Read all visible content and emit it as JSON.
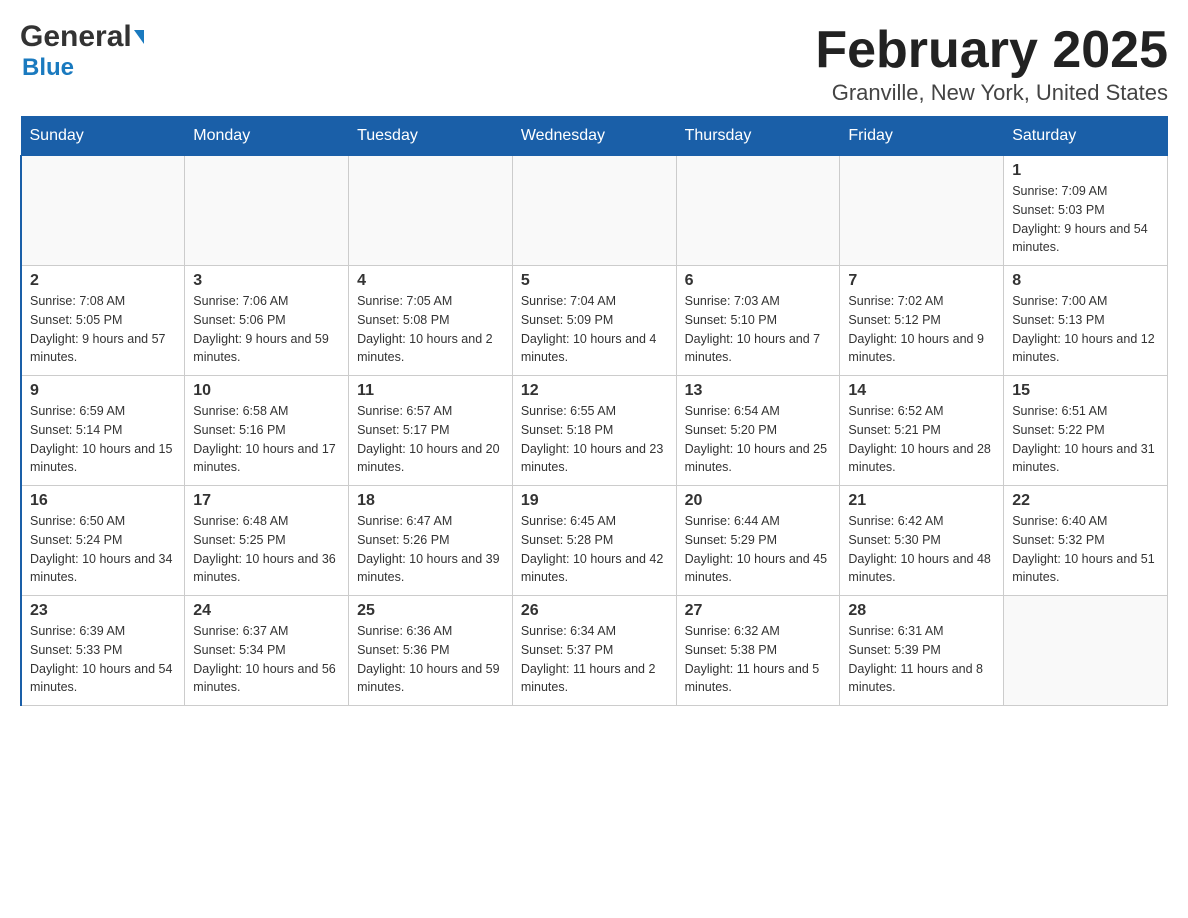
{
  "header": {
    "logo_line1": "General",
    "logo_line2": "Blue",
    "title": "February 2025",
    "subtitle": "Granville, New York, United States"
  },
  "days_of_week": [
    "Sunday",
    "Monday",
    "Tuesday",
    "Wednesday",
    "Thursday",
    "Friday",
    "Saturday"
  ],
  "weeks": [
    [
      {
        "day": "",
        "info": ""
      },
      {
        "day": "",
        "info": ""
      },
      {
        "day": "",
        "info": ""
      },
      {
        "day": "",
        "info": ""
      },
      {
        "day": "",
        "info": ""
      },
      {
        "day": "",
        "info": ""
      },
      {
        "day": "1",
        "info": "Sunrise: 7:09 AM\nSunset: 5:03 PM\nDaylight: 9 hours and 54 minutes."
      }
    ],
    [
      {
        "day": "2",
        "info": "Sunrise: 7:08 AM\nSunset: 5:05 PM\nDaylight: 9 hours and 57 minutes."
      },
      {
        "day": "3",
        "info": "Sunrise: 7:06 AM\nSunset: 5:06 PM\nDaylight: 9 hours and 59 minutes."
      },
      {
        "day": "4",
        "info": "Sunrise: 7:05 AM\nSunset: 5:08 PM\nDaylight: 10 hours and 2 minutes."
      },
      {
        "day": "5",
        "info": "Sunrise: 7:04 AM\nSunset: 5:09 PM\nDaylight: 10 hours and 4 minutes."
      },
      {
        "day": "6",
        "info": "Sunrise: 7:03 AM\nSunset: 5:10 PM\nDaylight: 10 hours and 7 minutes."
      },
      {
        "day": "7",
        "info": "Sunrise: 7:02 AM\nSunset: 5:12 PM\nDaylight: 10 hours and 9 minutes."
      },
      {
        "day": "8",
        "info": "Sunrise: 7:00 AM\nSunset: 5:13 PM\nDaylight: 10 hours and 12 minutes."
      }
    ],
    [
      {
        "day": "9",
        "info": "Sunrise: 6:59 AM\nSunset: 5:14 PM\nDaylight: 10 hours and 15 minutes."
      },
      {
        "day": "10",
        "info": "Sunrise: 6:58 AM\nSunset: 5:16 PM\nDaylight: 10 hours and 17 minutes."
      },
      {
        "day": "11",
        "info": "Sunrise: 6:57 AM\nSunset: 5:17 PM\nDaylight: 10 hours and 20 minutes."
      },
      {
        "day": "12",
        "info": "Sunrise: 6:55 AM\nSunset: 5:18 PM\nDaylight: 10 hours and 23 minutes."
      },
      {
        "day": "13",
        "info": "Sunrise: 6:54 AM\nSunset: 5:20 PM\nDaylight: 10 hours and 25 minutes."
      },
      {
        "day": "14",
        "info": "Sunrise: 6:52 AM\nSunset: 5:21 PM\nDaylight: 10 hours and 28 minutes."
      },
      {
        "day": "15",
        "info": "Sunrise: 6:51 AM\nSunset: 5:22 PM\nDaylight: 10 hours and 31 minutes."
      }
    ],
    [
      {
        "day": "16",
        "info": "Sunrise: 6:50 AM\nSunset: 5:24 PM\nDaylight: 10 hours and 34 minutes."
      },
      {
        "day": "17",
        "info": "Sunrise: 6:48 AM\nSunset: 5:25 PM\nDaylight: 10 hours and 36 minutes."
      },
      {
        "day": "18",
        "info": "Sunrise: 6:47 AM\nSunset: 5:26 PM\nDaylight: 10 hours and 39 minutes."
      },
      {
        "day": "19",
        "info": "Sunrise: 6:45 AM\nSunset: 5:28 PM\nDaylight: 10 hours and 42 minutes."
      },
      {
        "day": "20",
        "info": "Sunrise: 6:44 AM\nSunset: 5:29 PM\nDaylight: 10 hours and 45 minutes."
      },
      {
        "day": "21",
        "info": "Sunrise: 6:42 AM\nSunset: 5:30 PM\nDaylight: 10 hours and 48 minutes."
      },
      {
        "day": "22",
        "info": "Sunrise: 6:40 AM\nSunset: 5:32 PM\nDaylight: 10 hours and 51 minutes."
      }
    ],
    [
      {
        "day": "23",
        "info": "Sunrise: 6:39 AM\nSunset: 5:33 PM\nDaylight: 10 hours and 54 minutes."
      },
      {
        "day": "24",
        "info": "Sunrise: 6:37 AM\nSunset: 5:34 PM\nDaylight: 10 hours and 56 minutes."
      },
      {
        "day": "25",
        "info": "Sunrise: 6:36 AM\nSunset: 5:36 PM\nDaylight: 10 hours and 59 minutes."
      },
      {
        "day": "26",
        "info": "Sunrise: 6:34 AM\nSunset: 5:37 PM\nDaylight: 11 hours and 2 minutes."
      },
      {
        "day": "27",
        "info": "Sunrise: 6:32 AM\nSunset: 5:38 PM\nDaylight: 11 hours and 5 minutes."
      },
      {
        "day": "28",
        "info": "Sunrise: 6:31 AM\nSunset: 5:39 PM\nDaylight: 11 hours and 8 minutes."
      },
      {
        "day": "",
        "info": ""
      }
    ]
  ]
}
